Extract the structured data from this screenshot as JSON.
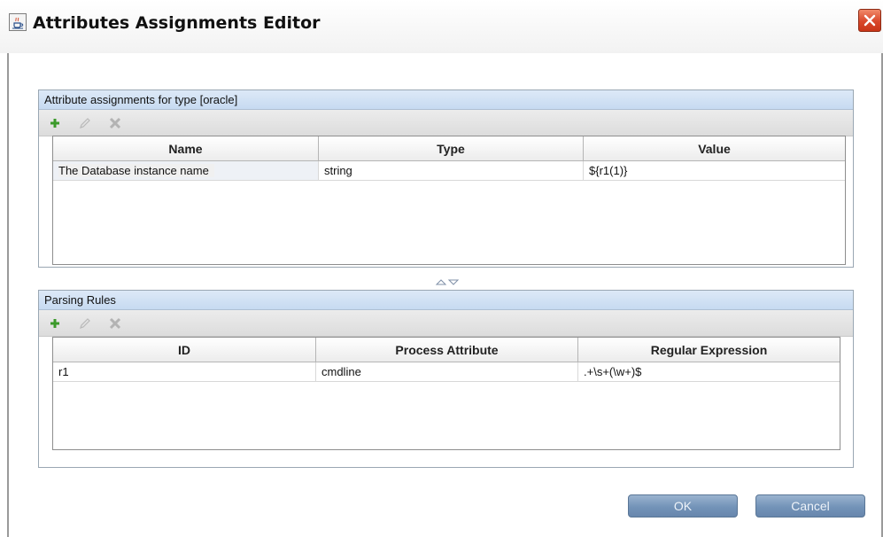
{
  "window": {
    "title": "Attributes Assignments Editor",
    "icon": "java-cup-icon",
    "close_icon": "close-icon"
  },
  "attributes_panel": {
    "header": "Attribute assignments for type [oracle]",
    "toolbar": {
      "add": "plus-icon",
      "edit": "pencil-icon",
      "delete": "x-icon"
    },
    "columns": [
      "Name",
      "Type",
      "Value"
    ],
    "rows": [
      {
        "name": "The Database instance name",
        "type": "string",
        "value": "${r1(1)}"
      }
    ]
  },
  "splitter_icon": "split-arrows-icon",
  "parsing_panel": {
    "header": "Parsing Rules",
    "toolbar": {
      "add": "plus-icon",
      "edit": "pencil-icon",
      "delete": "x-icon"
    },
    "columns": [
      "ID",
      "Process Attribute",
      "Regular Expression"
    ],
    "rows": [
      {
        "id": "r1",
        "process_attribute": "cmdline",
        "regex": ".+\\s+(\\w+)$"
      }
    ]
  },
  "buttons": {
    "ok": "OK",
    "cancel": "Cancel"
  },
  "colors": {
    "panel_header": "#c6daf1",
    "button": "#7393b8",
    "close_button": "#d9472b",
    "add_icon": "#3c9a2b"
  }
}
